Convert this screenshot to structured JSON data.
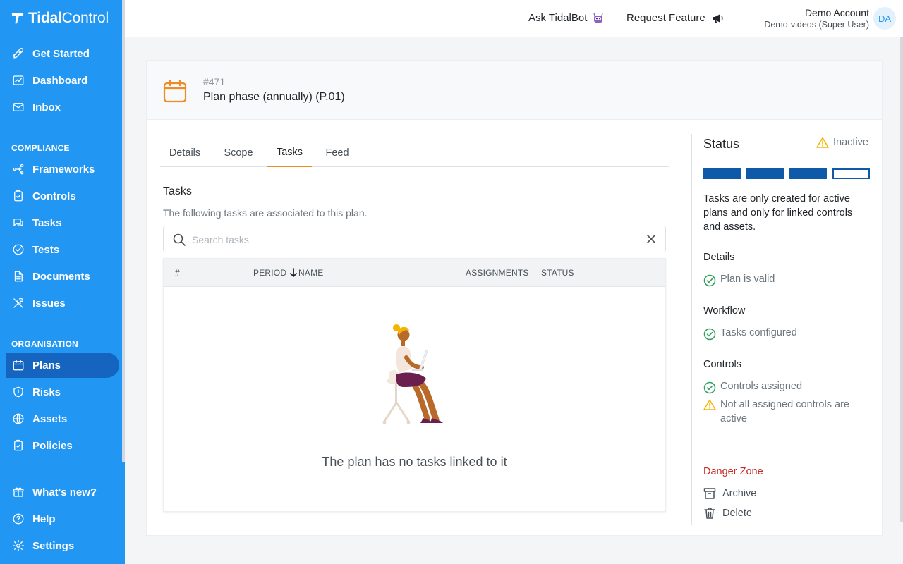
{
  "app": {
    "logo_bold": "Tidal",
    "logo_light": "Control"
  },
  "sidebar": {
    "top_items": [
      {
        "label": "Get Started",
        "icon": "rocket-icon"
      },
      {
        "label": "Dashboard",
        "icon": "dashboard-icon"
      },
      {
        "label": "Inbox",
        "icon": "mail-icon"
      }
    ],
    "compliance_label": "COMPLIANCE",
    "compliance_items": [
      {
        "label": "Frameworks",
        "icon": "frameworks-icon"
      },
      {
        "label": "Controls",
        "icon": "controls-icon"
      },
      {
        "label": "Tasks",
        "icon": "chat-icon"
      },
      {
        "label": "Tests",
        "icon": "check-circle-icon"
      },
      {
        "label": "Documents",
        "icon": "document-icon"
      },
      {
        "label": "Issues",
        "icon": "tools-icon"
      }
    ],
    "organisation_label": "ORGANISATION",
    "organisation_items": [
      {
        "label": "Plans",
        "icon": "calendar-icon",
        "active": true
      },
      {
        "label": "Risks",
        "icon": "shield-icon"
      },
      {
        "label": "Assets",
        "icon": "globe-icon"
      },
      {
        "label": "Policies",
        "icon": "policy-icon"
      }
    ],
    "bottom_items": [
      {
        "label": "What's new?",
        "icon": "gift-icon"
      },
      {
        "label": "Help",
        "icon": "help-icon"
      },
      {
        "label": "Settings",
        "icon": "gear-icon"
      }
    ],
    "accent": "#2196f3",
    "active_bg": "#1565c0"
  },
  "topbar": {
    "ask_label": "Ask TidalBot",
    "request_label": "Request Feature",
    "user_name": "Demo Account",
    "user_sub": "Demo-videos (Super User)",
    "avatar_initials": "DA"
  },
  "plan": {
    "id": "#471",
    "title": "Plan phase (annually) (P.01)"
  },
  "tabs": [
    {
      "label": "Details"
    },
    {
      "label": "Scope"
    },
    {
      "label": "Tasks",
      "active": true
    },
    {
      "label": "Feed"
    }
  ],
  "tasks": {
    "title": "Tasks",
    "subtitle": "The following tasks are associated to this plan.",
    "search_placeholder": "Search tasks",
    "search_value": "",
    "columns": [
      "#",
      "PERIOD",
      "NAME",
      "ASSIGNMENTS",
      "STATUS"
    ],
    "rows": [],
    "empty_message": "The plan has no tasks linked to it"
  },
  "status": {
    "title": "Status",
    "badge": "Inactive",
    "steps_filled": 3,
    "steps_total": 4,
    "description": "Tasks are only created for active plans and only for linked controls and assets.",
    "groups": [
      {
        "title": "Details",
        "checks": [
          {
            "text": "Plan is valid",
            "state": "ok"
          }
        ]
      },
      {
        "title": "Workflow",
        "checks": [
          {
            "text": "Tasks configured",
            "state": "ok"
          }
        ]
      },
      {
        "title": "Controls",
        "checks": [
          {
            "text": "Controls assigned",
            "state": "ok"
          },
          {
            "text": "Not all assigned controls are active",
            "state": "warning"
          }
        ]
      }
    ],
    "danger_title": "Danger Zone",
    "archive_label": "Archive",
    "delete_label": "Delete"
  },
  "colors": {
    "ok": "#2e9e5b",
    "warning": "#f5b400",
    "danger": "#c62828",
    "tab_accent": "#f08a24",
    "step": "#0f5aa8"
  }
}
